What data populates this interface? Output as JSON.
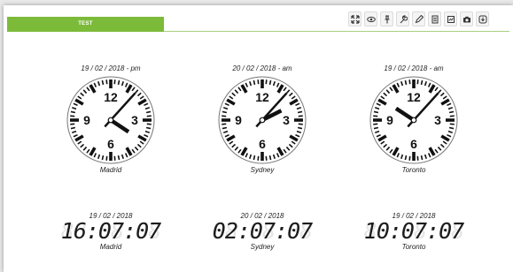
{
  "tab": {
    "label": "TEST"
  },
  "toolbar": {
    "buttons": [
      {
        "icon": "expand-icon"
      },
      {
        "icon": "eye-icon"
      },
      {
        "icon": "pin-icon"
      },
      {
        "icon": "wrench-icon"
      },
      {
        "icon": "pencil-icon"
      },
      {
        "icon": "document-icon"
      },
      {
        "icon": "chart-icon"
      },
      {
        "icon": "camera-icon"
      },
      {
        "icon": "download-icon"
      }
    ]
  },
  "analog_clocks": [
    {
      "date": "19 / 02 / 2018 - pm",
      "city": "Madrid",
      "hour": 4,
      "minute": 7
    },
    {
      "date": "20 / 02 / 2018 - am",
      "city": "Sydney",
      "hour": 2,
      "minute": 7
    },
    {
      "date": "19 / 02 / 2018 - am",
      "city": "Toronto",
      "hour": 10,
      "minute": 7
    }
  ],
  "digital_clocks": [
    {
      "date": "19 / 02 / 2018",
      "time": "16:07:07",
      "city": "Madrid"
    },
    {
      "date": "20 / 02 / 2018",
      "time": "02:07:07",
      "city": "Sydney"
    },
    {
      "date": "19 / 02 / 2018",
      "time": "10:07:07",
      "city": "Toronto"
    }
  ],
  "dial_numbers": {
    "n12": "12",
    "n3": "3",
    "n6": "6",
    "n9": "9"
  },
  "colors": {
    "accent": "#7cbb3a",
    "hands": "#111111"
  }
}
